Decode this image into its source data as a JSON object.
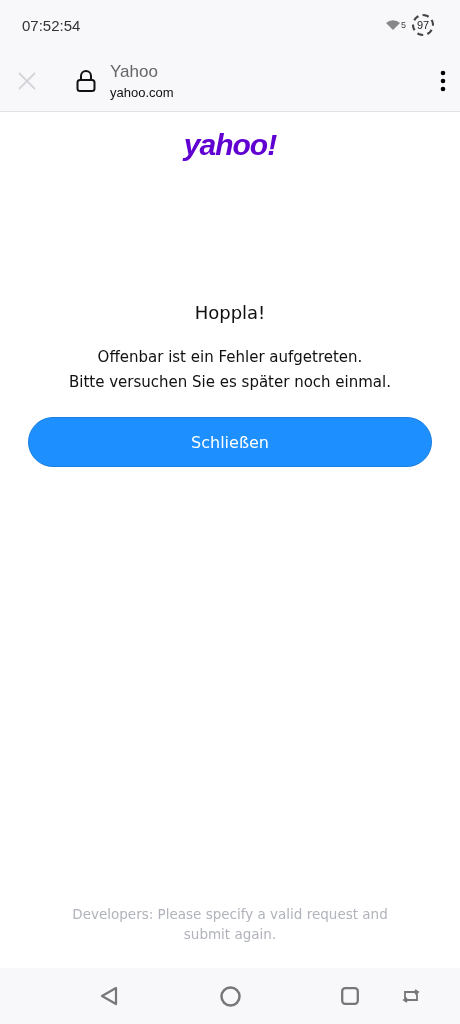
{
  "status_bar": {
    "time": "07:52:54",
    "wifi_badge": "5",
    "battery": "97"
  },
  "browser_toolbar": {
    "title": "Yahoo",
    "url": "yahoo.com"
  },
  "page": {
    "logo": "yahoo!",
    "heading": "Hoppla!",
    "message": [
      "Offenbar ist ein Fehler aufgetreten.",
      "Bitte versuchen Sie es später noch einmal."
    ],
    "button": "Schließen",
    "footer": "Developers: Please specify a valid request and submit again."
  }
}
